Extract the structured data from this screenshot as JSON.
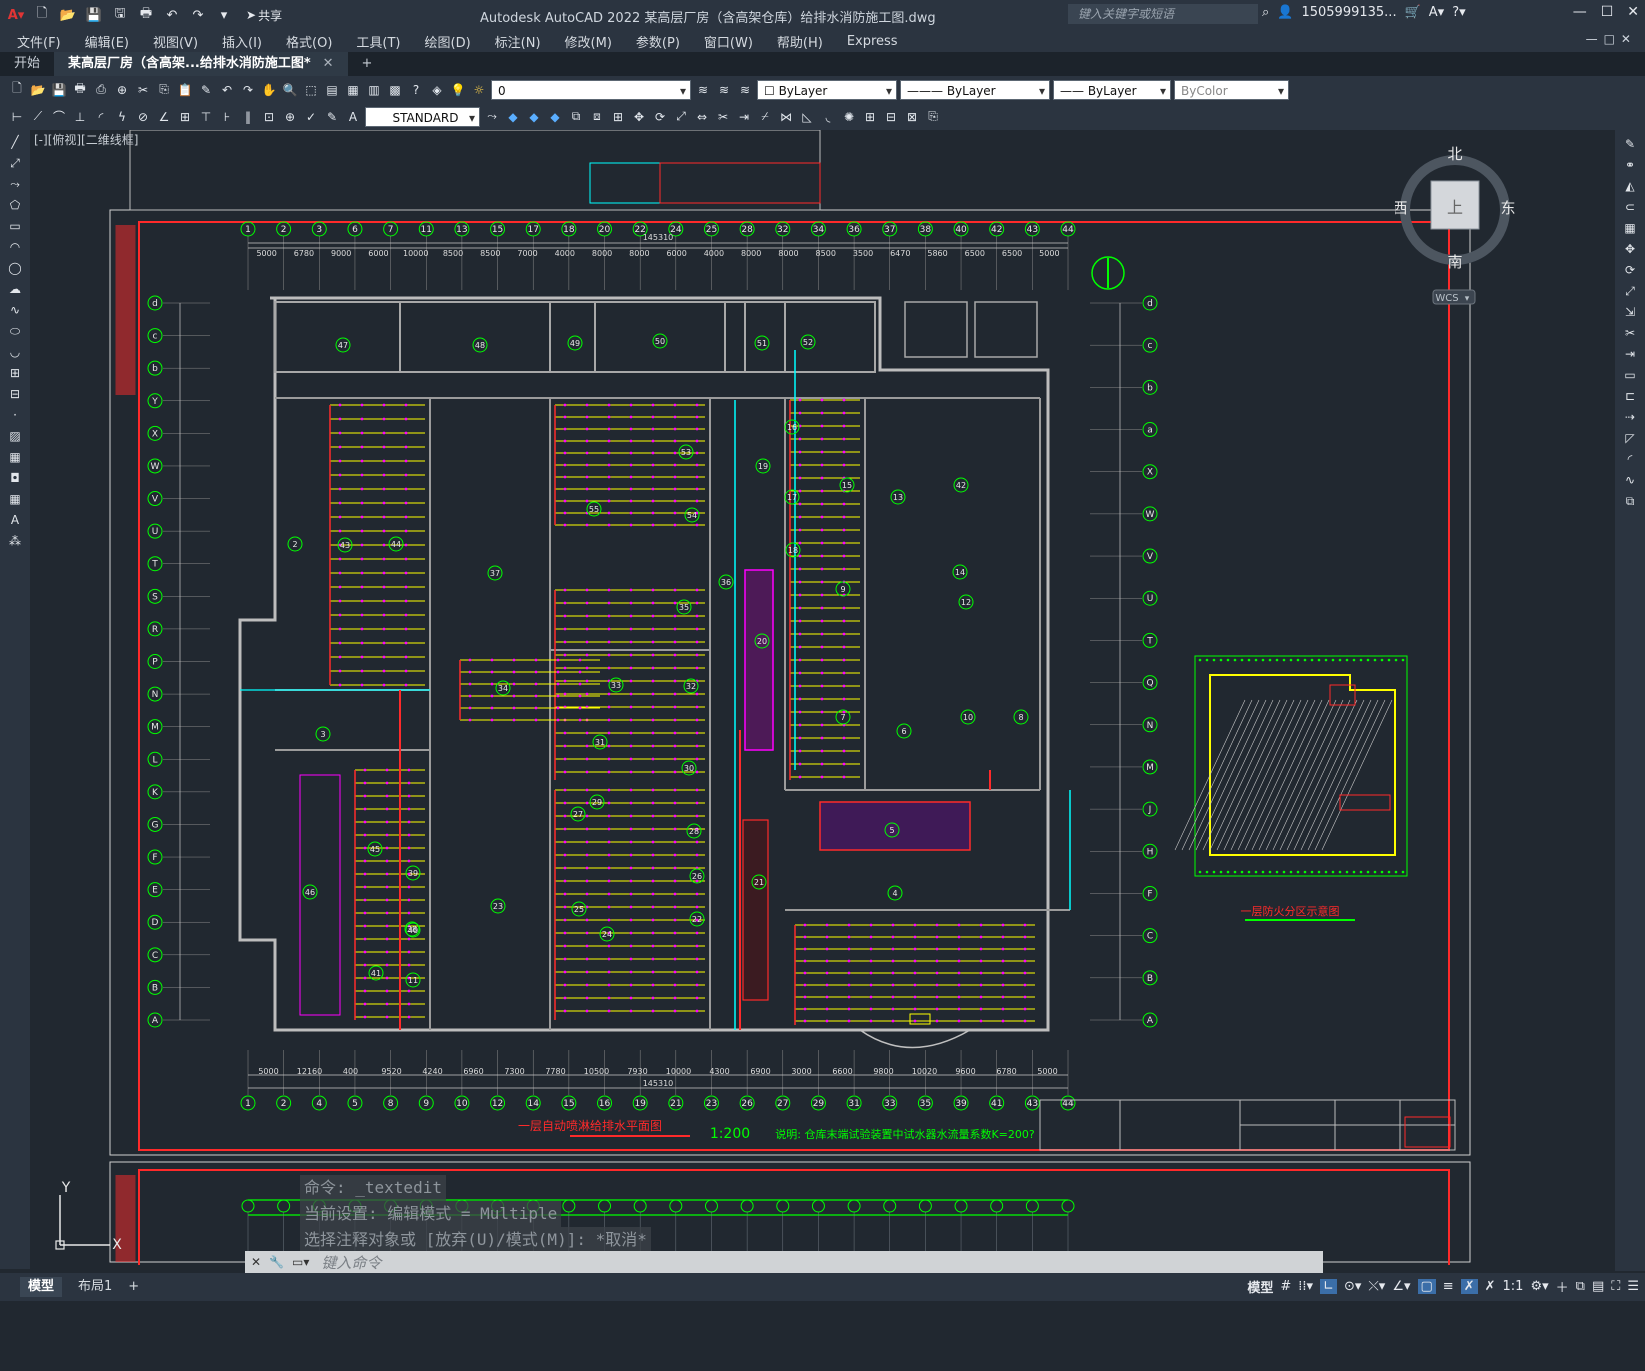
{
  "app": {
    "title": "Autodesk AutoCAD 2022    某高层厂房（含高架仓库）给排水消防施工图.dwg",
    "search_placeholder": "键入关键字或短语",
    "user": "1505999135...",
    "share_label": "共享"
  },
  "menu": [
    "文件(F)",
    "编辑(E)",
    "视图(V)",
    "插入(I)",
    "格式(O)",
    "工具(T)",
    "绘图(D)",
    "标注(N)",
    "修改(M)",
    "参数(P)",
    "窗口(W)",
    "帮助(H)",
    "Express"
  ],
  "tabs": [
    {
      "label": "开始",
      "active": false
    },
    {
      "label": "某高层厂房（含高架...给排水消防施工图*",
      "active": true
    }
  ],
  "toolbar": {
    "layer": "0",
    "color": "ByLayer",
    "linetype": "ByLayer",
    "lineweight": "ByLayer",
    "plotstyle": "ByColor",
    "textstyle": "STANDARD"
  },
  "viewport_label": "[-][俯视][二维线框]",
  "viewcube": {
    "north": "北",
    "south": "南",
    "east": "东",
    "west": "西",
    "top": "上",
    "wcs": "WCS"
  },
  "drawing": {
    "top_axes": [
      "1",
      "2",
      "3",
      "6",
      "7",
      "11",
      "13",
      "15",
      "17",
      "18",
      "20",
      "22",
      "24",
      "25",
      "28",
      "32",
      "34",
      "36",
      "37",
      "38",
      "40",
      "42",
      "43",
      "44"
    ],
    "top_dims": [
      "5000",
      "6780",
      "9000",
      "6000",
      "10000",
      "8500",
      "8500",
      "7000",
      "4000",
      "8000",
      "8000",
      "6000",
      "4000",
      "8000",
      "8000",
      "8500",
      "3500",
      "6470",
      "5860",
      "6500",
      "6500",
      "5000"
    ],
    "overall_dim": "145310",
    "bottom_axes": [
      "1",
      "2",
      "4",
      "5",
      "8",
      "9",
      "10",
      "12",
      "14",
      "15",
      "16",
      "19",
      "21",
      "23",
      "26",
      "27",
      "29",
      "31",
      "33",
      "35",
      "39",
      "41",
      "43",
      "44"
    ],
    "bottom_dims": [
      "5000",
      "12160",
      "400",
      "9520",
      "4240",
      "6960",
      "7300",
      "7780",
      "10500",
      "7930",
      "10000",
      "4300",
      "6900",
      "3000",
      "6600",
      "9800",
      "10020",
      "9600",
      "6780",
      "5000"
    ],
    "left_axes": [
      "d",
      "c",
      "b",
      "Y",
      "X",
      "W",
      "V",
      "U",
      "T",
      "S",
      "R",
      "P",
      "N",
      "M",
      "L",
      "K",
      "G",
      "F",
      "E",
      "D",
      "C",
      "B",
      "A"
    ],
    "right_axes": [
      "d",
      "c",
      "b",
      "a",
      "X",
      "W",
      "V",
      "U",
      "T",
      "Q",
      "N",
      "M",
      "J",
      "H",
      "F",
      "C",
      "B",
      "A"
    ],
    "plan_title": "一层自动喷淋给排水平面图",
    "plan_scale": "1:200",
    "note": "说明: 仓库末端试验装置中试水器水流量系数K=200?",
    "inset_title": "一层防火分区示意图",
    "room_labels": [
      "47",
      "48",
      "49",
      "50",
      "51",
      "52",
      "53",
      "54",
      "55",
      "37",
      "36",
      "35",
      "34",
      "33",
      "32",
      "31",
      "30",
      "29",
      "28",
      "27",
      "26",
      "25",
      "24",
      "23",
      "22",
      "21",
      "20",
      "19",
      "18",
      "17",
      "16",
      "15",
      "14",
      "13",
      "12",
      "9",
      "10",
      "8",
      "6",
      "7",
      "5",
      "4",
      "3",
      "2",
      "43",
      "44",
      "45",
      "46",
      "41",
      "40",
      "39",
      "38",
      "42",
      "11"
    ]
  },
  "command": {
    "history": [
      "命令: _textedit",
      "当前设置: 编辑模式 = Multiple",
      "选择注释对象或 [放弃(U)/模式(M)]: *取消*"
    ],
    "placeholder": "键入命令"
  },
  "status": {
    "layout_tabs": [
      "模型",
      "布局1"
    ],
    "model_label": "模型",
    "scale": "1:1"
  },
  "colors": {
    "accent_red": "#ff2a2a",
    "cad_yellow": "#ffff00",
    "cad_green": "#00ff00",
    "cad_magenta": "#ff00ff",
    "cad_cyan": "#00ffff",
    "bg": "#212830"
  }
}
